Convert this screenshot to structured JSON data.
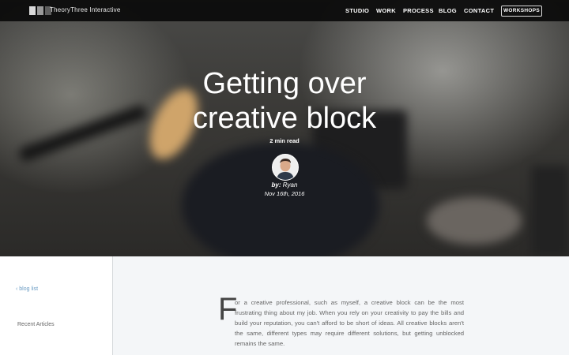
{
  "header": {
    "brand": "TheoryThree Interactive",
    "nav": [
      "STUDIO",
      "WORK",
      "PROCESS",
      "BLOG",
      "CONTACT"
    ],
    "workshops_label": "WORKSHOPS"
  },
  "hero": {
    "title_line1": "Getting over",
    "title_line2": "creative block",
    "read_time": "2 min read",
    "byline_prefix": "by:",
    "author": "Ryan",
    "date": "Nov 16th, 2016"
  },
  "sidebar": {
    "back_link": "‹ blog list",
    "recent_heading": "Recent Articles"
  },
  "article": {
    "dropcap": "F",
    "body": "or a creative professional, such as myself, a creative block can be the most frustrating thing about my job. When you rely on your creativity to pay the bills and build your reputation, you can't afford to be short of ideas. All creative blocks aren't the same, different types may require different solutions, but getting unblocked remains the same."
  },
  "colors": {
    "nav_bg": "#0a0a0a",
    "hero_text": "#ffffff",
    "link": "#6a9bc3",
    "body_text": "#666666",
    "page_bg": "#f4f6f8"
  }
}
